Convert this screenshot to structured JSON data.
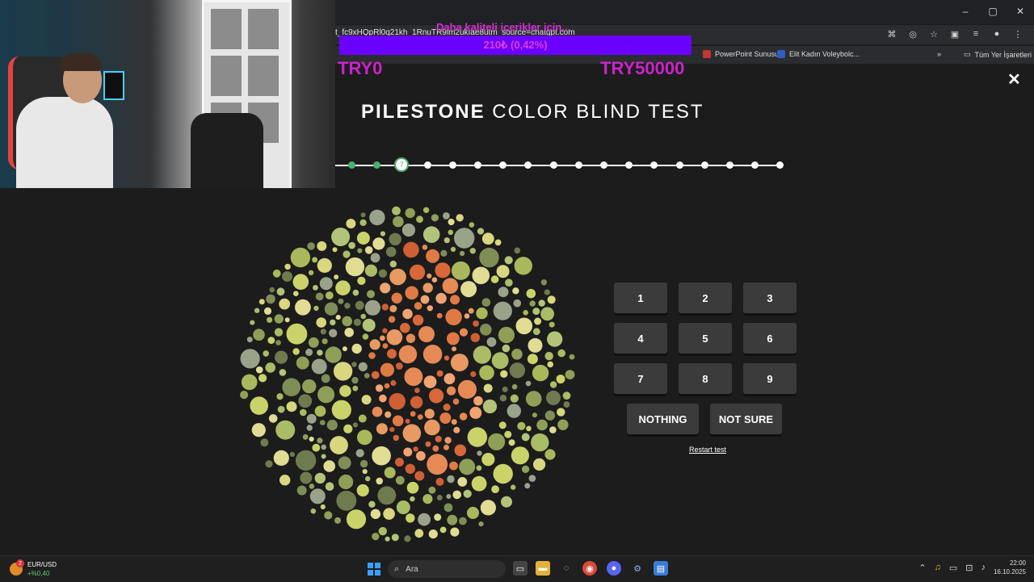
{
  "browser": {
    "url": "t_fc9xHQpRl0q21kh_1RnuTR9lm2ukIae8utm_source=chatgpt.com",
    "bookmarks": [
      "PowerPoint Sunusu",
      "Elit Kadın Voleybolc...",
      "Tüm Yer İşaretleri"
    ],
    "window_controls": {
      "minimize": "–",
      "maximize": "▢",
      "close": "✕"
    }
  },
  "stream_overlay": {
    "donation_text": "Daha kaliteli içerikler için...",
    "goal_label": "210₺ (0,42%)",
    "goal_progress": 0.0042,
    "goal_min": "TRY0",
    "goal_max": "TRY50000",
    "accent": "#6a00ff"
  },
  "test": {
    "title_bold": "PILESTONE",
    "title_light": "COLOR BLIND TEST",
    "progress": {
      "total": 18,
      "completed": 2,
      "current_label": "7"
    },
    "answer_buttons": [
      "1",
      "2",
      "3",
      "4",
      "5",
      "6",
      "7",
      "8",
      "9"
    ],
    "nothing_label": "NOTHING",
    "not_sure_label": "NOT SURE",
    "restart_label": "Restart test",
    "close_icon": "✕",
    "accent_green": "#4cb071"
  },
  "taskbar": {
    "ticker_symbol": "EUR/USD",
    "ticker_change": "+%0,40",
    "ticker_badge": "2",
    "search_placeholder": "Ara",
    "time": "22:00",
    "date": "16.10.2025"
  }
}
